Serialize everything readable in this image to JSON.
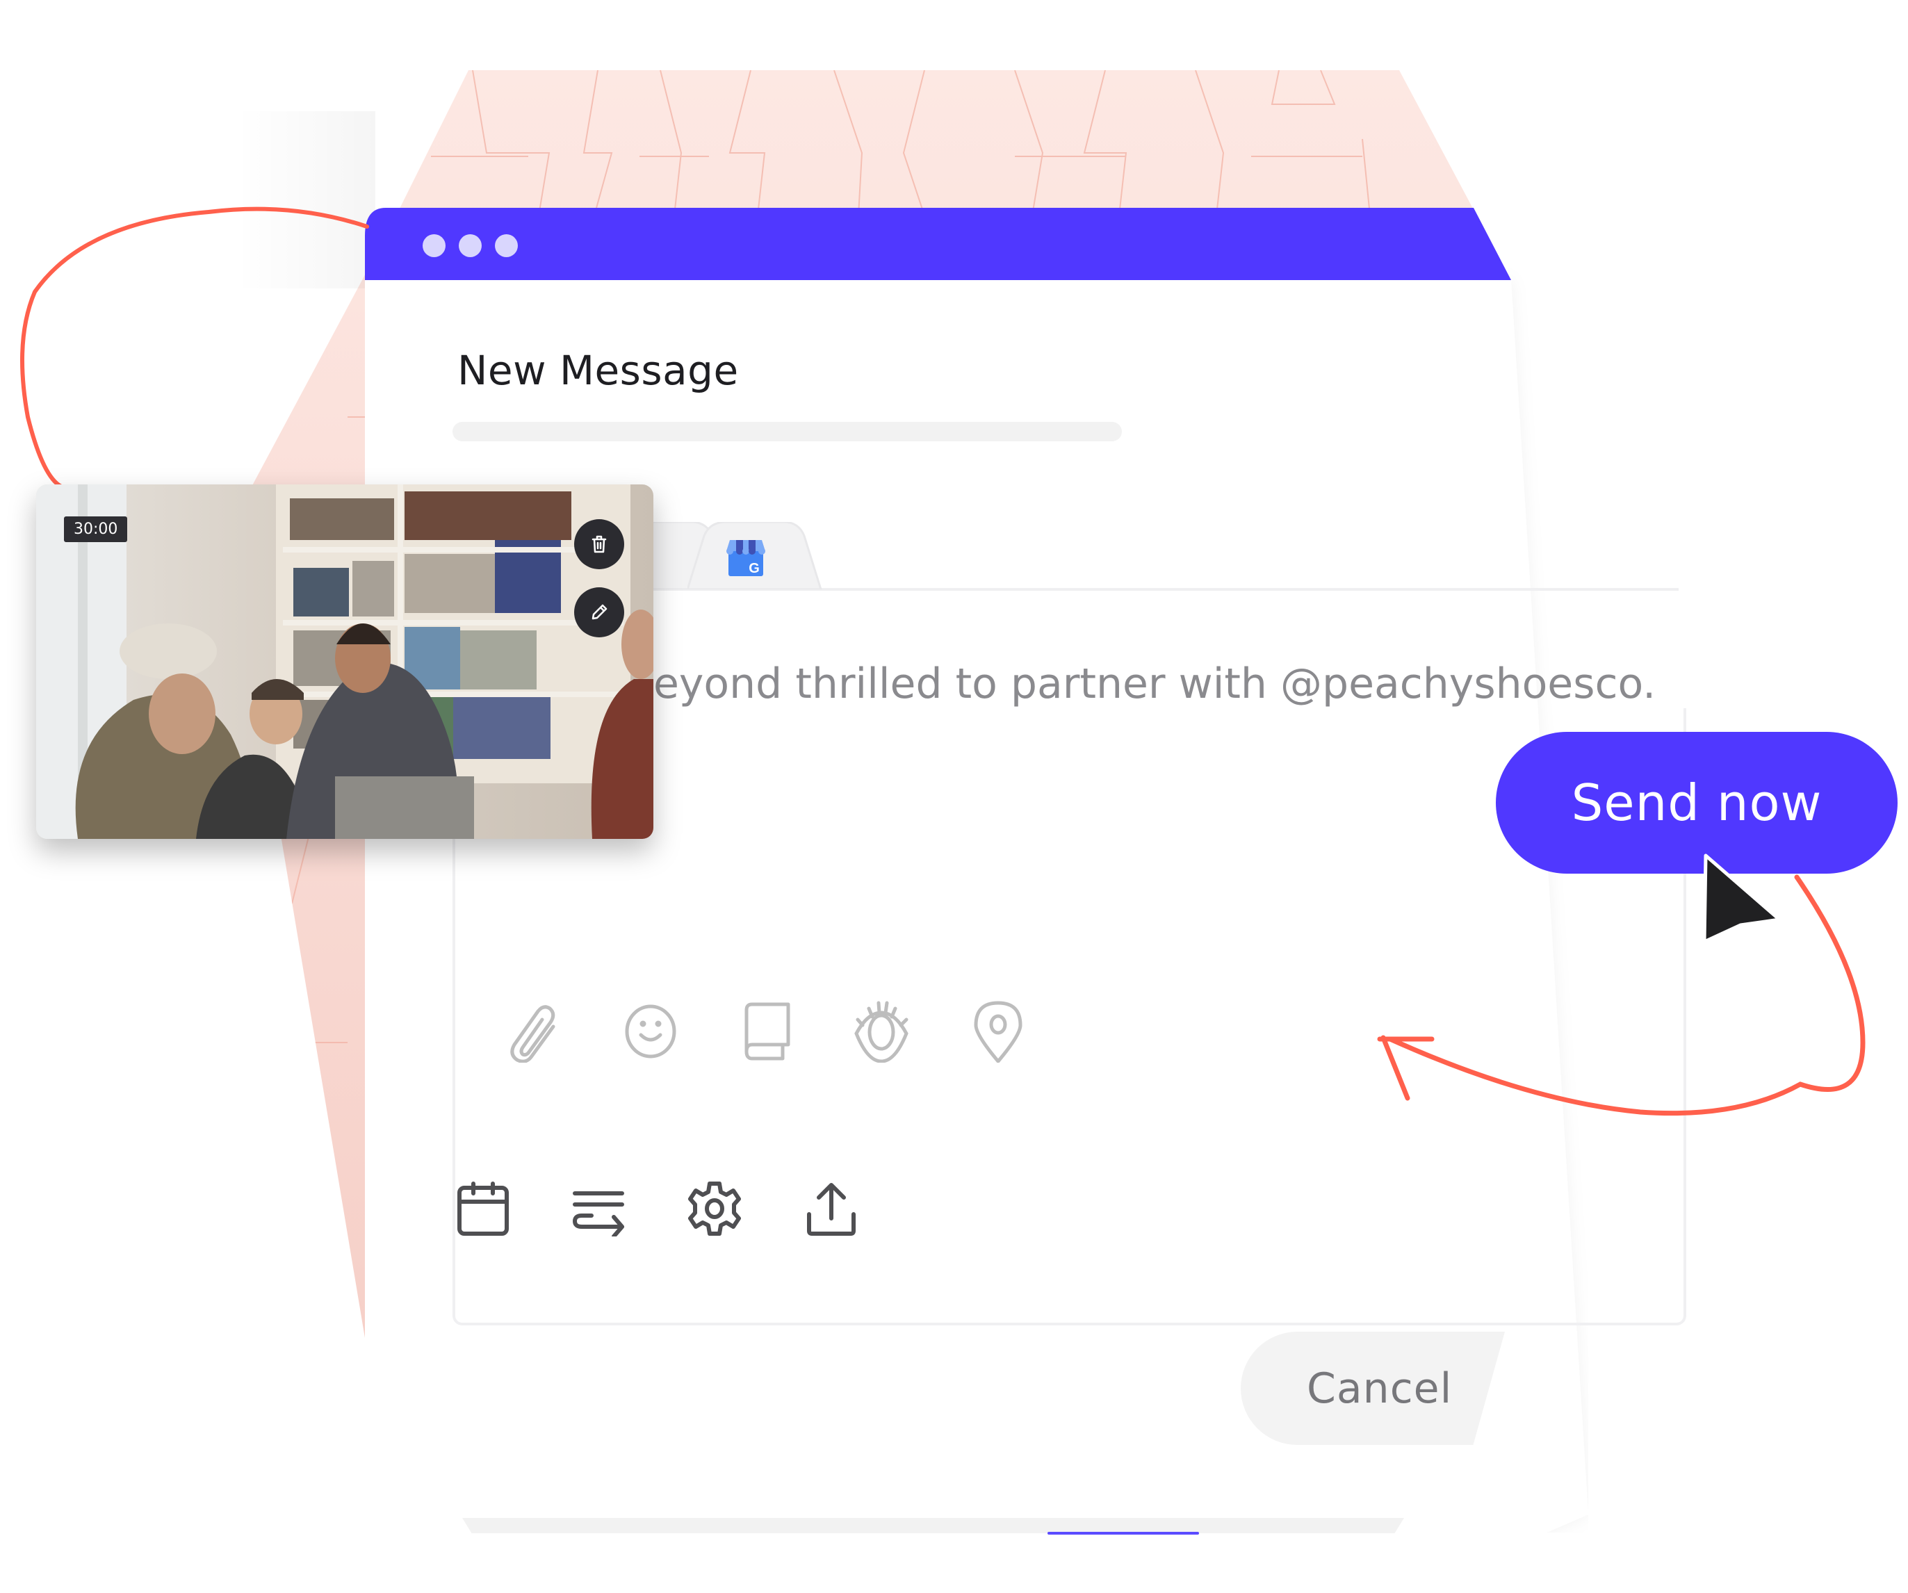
{
  "window": {
    "title": "New Message",
    "header_color": "#5038ff",
    "dots": [
      "dot",
      "dot",
      "dot"
    ]
  },
  "composer": {
    "subject_placeholder": "",
    "tabs": [
      {
        "name": "previous-network-tab",
        "icon": "hidden-network-icon"
      },
      {
        "name": "google-my-business-tab",
        "icon": "google-my-business-icon"
      }
    ],
    "body_text": "eyond thrilled to partner with @peachyshoesco.",
    "editor_icons": [
      "paperclip-icon",
      "smiley-icon",
      "book-icon",
      "eye-icon",
      "location-pin-icon"
    ],
    "toolbar_icons": [
      "calendar-icon",
      "text-wrap-icon",
      "gear-icon",
      "upload-icon"
    ]
  },
  "buttons": {
    "send_now": "Send now",
    "cancel": "Cancel"
  },
  "media": {
    "duration": "30:00",
    "actions": [
      "delete",
      "edit"
    ]
  },
  "colors": {
    "accent": "#5038ff",
    "annotation": "#ff604c",
    "pattern_bg": "#fbe0da"
  }
}
